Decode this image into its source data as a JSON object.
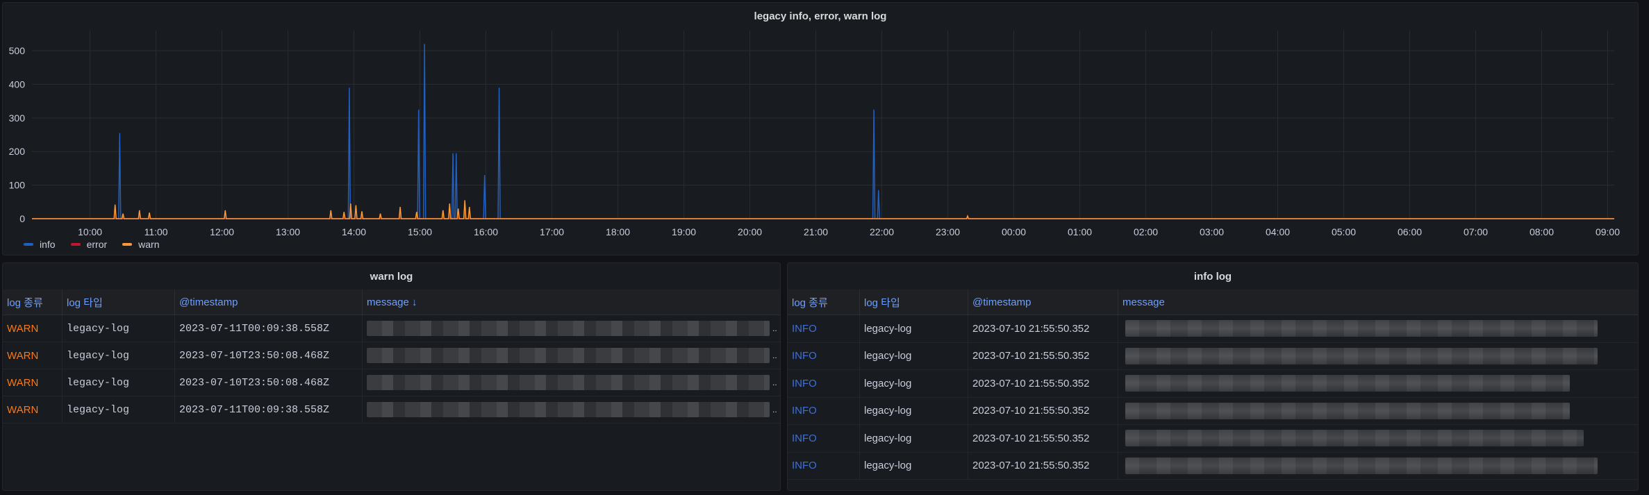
{
  "chart_panel": {
    "title": "legacy info, error, warn log",
    "legend": [
      {
        "name": "info",
        "color": "#1f60c4"
      },
      {
        "name": "error",
        "color": "#c4162a"
      },
      {
        "name": "warn",
        "color": "#ff9830"
      }
    ]
  },
  "chart_data": {
    "type": "line",
    "title": "legacy info, error, warn log",
    "xlabel": "",
    "ylabel": "",
    "ylim": [
      0,
      560
    ],
    "y_ticks": [
      0,
      100,
      200,
      300,
      400,
      500
    ],
    "x_tick_labels": [
      "10:00",
      "11:00",
      "12:00",
      "13:00",
      "14:00",
      "15:00",
      "16:00",
      "17:00",
      "18:00",
      "19:00",
      "20:00",
      "21:00",
      "22:00",
      "23:00",
      "00:00",
      "01:00",
      "02:00",
      "03:00",
      "04:00",
      "05:00",
      "06:00",
      "07:00",
      "08:00",
      "09:00"
    ],
    "x_range_hours": [
      9.12,
      33.1
    ],
    "grid": true,
    "legend_position": "bottom-left",
    "series": [
      {
        "name": "info",
        "color": "#1f60c4",
        "spikes": [
          {
            "t": 10.45,
            "v": 255
          },
          {
            "t": 13.93,
            "v": 390
          },
          {
            "t": 14.98,
            "v": 325
          },
          {
            "t": 15.07,
            "v": 520
          },
          {
            "t": 15.5,
            "v": 195
          },
          {
            "t": 15.55,
            "v": 195
          },
          {
            "t": 15.98,
            "v": 130
          },
          {
            "t": 16.2,
            "v": 390
          },
          {
            "t": 21.88,
            "v": 325
          },
          {
            "t": 21.95,
            "v": 85
          }
        ]
      },
      {
        "name": "error",
        "color": "#c4162a",
        "spikes": []
      },
      {
        "name": "warn",
        "color": "#ff9830",
        "spikes": [
          {
            "t": 10.38,
            "v": 42
          },
          {
            "t": 10.5,
            "v": 15
          },
          {
            "t": 10.75,
            "v": 25
          },
          {
            "t": 10.9,
            "v": 18
          },
          {
            "t": 12.05,
            "v": 25
          },
          {
            "t": 13.65,
            "v": 25
          },
          {
            "t": 13.85,
            "v": 20
          },
          {
            "t": 13.95,
            "v": 45
          },
          {
            "t": 14.03,
            "v": 40
          },
          {
            "t": 14.12,
            "v": 22
          },
          {
            "t": 14.4,
            "v": 15
          },
          {
            "t": 14.7,
            "v": 35
          },
          {
            "t": 14.95,
            "v": 20
          },
          {
            "t": 15.35,
            "v": 25
          },
          {
            "t": 15.45,
            "v": 45
          },
          {
            "t": 15.58,
            "v": 30
          },
          {
            "t": 15.68,
            "v": 55
          },
          {
            "t": 15.75,
            "v": 35
          },
          {
            "t": 23.3,
            "v": 8
          }
        ]
      }
    ]
  },
  "warn_panel": {
    "title": "warn log",
    "columns": [
      "log 종류",
      "log 타입",
      "@timestamp",
      "message ↓"
    ],
    "rows": [
      {
        "level": "WARN",
        "type": "legacy-log",
        "timestamp": "2023-07-11T00:09:38.558Z",
        "message_suffix": ".."
      },
      {
        "level": "WARN",
        "type": "legacy-log",
        "timestamp": "2023-07-10T23:50:08.468Z",
        "message_suffix": ".."
      },
      {
        "level": "WARN",
        "type": "legacy-log",
        "timestamp": "2023-07-10T23:50:08.468Z",
        "message_suffix": ".."
      },
      {
        "level": "WARN",
        "type": "legacy-log",
        "timestamp": "2023-07-11T00:09:38.558Z",
        "message_suffix": ".."
      }
    ]
  },
  "info_panel": {
    "title": "info log",
    "columns": [
      "log 종류",
      "log 타입",
      "@timestamp",
      "message"
    ],
    "rows": [
      {
        "level": "INFO",
        "type": "legacy-log",
        "timestamp": "2023-07-10 21:55:50.352"
      },
      {
        "level": "INFO",
        "type": "legacy-log",
        "timestamp": "2023-07-10 21:55:50.352"
      },
      {
        "level": "INFO",
        "type": "legacy-log",
        "timestamp": "2023-07-10 21:55:50.352"
      },
      {
        "level": "INFO",
        "type": "legacy-log",
        "timestamp": "2023-07-10 21:55:50.352"
      },
      {
        "level": "INFO",
        "type": "legacy-log",
        "timestamp": "2023-07-10 21:55:50.352"
      },
      {
        "level": "INFO",
        "type": "legacy-log",
        "timestamp": "2023-07-10 21:55:50.352"
      }
    ]
  }
}
